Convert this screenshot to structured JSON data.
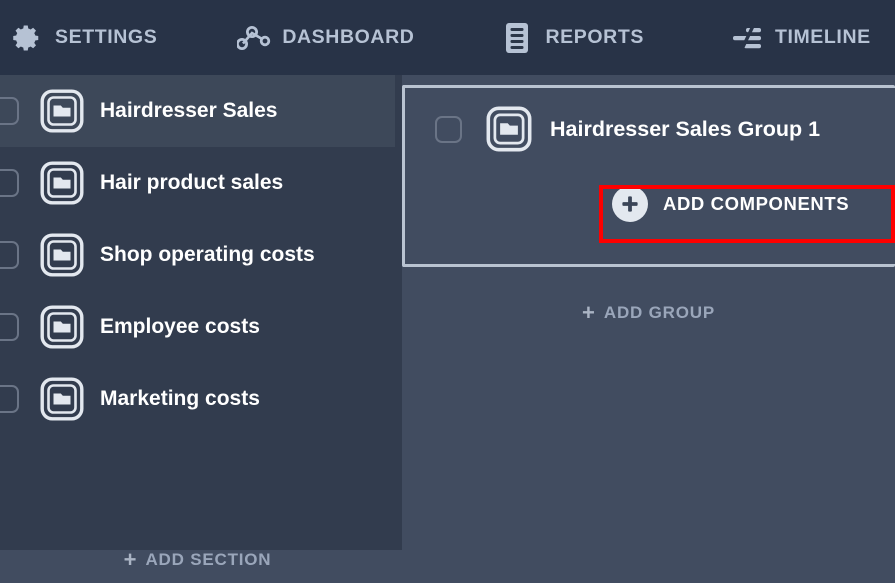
{
  "colors": {
    "toolbar_bg": "#283347",
    "sidebar_bg": "#323c4e",
    "sidebar_row_selected": "#3d4859",
    "panel_bg": "#414c60",
    "card_border": "#b9c3d1",
    "highlight_red": "#fe0000",
    "label_white": "#ffffff",
    "muted_text": "#9aa6ba",
    "toolbar_text": "#b6c2d4"
  },
  "toolbar": {
    "items": [
      {
        "label": "SETTINGS",
        "icon": "gear-icon"
      },
      {
        "label": "DASHBOARD",
        "icon": "network-nodes-icon"
      },
      {
        "label": "REPORTS",
        "icon": "document-lines-icon"
      },
      {
        "label": "TIMELINE",
        "icon": "timeline-bars-icon"
      }
    ]
  },
  "sidebar": {
    "sections": [
      {
        "label": "Hairdresser Sales",
        "icon": "folder-icon",
        "checked": false,
        "selected": true
      },
      {
        "label": "Hair product sales",
        "icon": "folder-icon",
        "checked": false,
        "selected": false
      },
      {
        "label": "Shop operating costs",
        "icon": "folder-icon",
        "checked": false,
        "selected": false
      },
      {
        "label": "Employee costs",
        "icon": "folder-icon",
        "checked": false,
        "selected": false
      },
      {
        "label": "Marketing costs",
        "icon": "folder-icon",
        "checked": false,
        "selected": false
      }
    ],
    "add_section": {
      "plus": "+",
      "label": "ADD SECTION"
    }
  },
  "right_panel": {
    "group_card": {
      "title": "Hairdresser Sales Group 1",
      "icon": "folder-icon",
      "checked": false,
      "add_components": {
        "plus": "+",
        "label": "ADD COMPONENTS"
      },
      "highlighted": true
    },
    "add_group": {
      "plus": "+",
      "label": "ADD GROUP"
    }
  }
}
